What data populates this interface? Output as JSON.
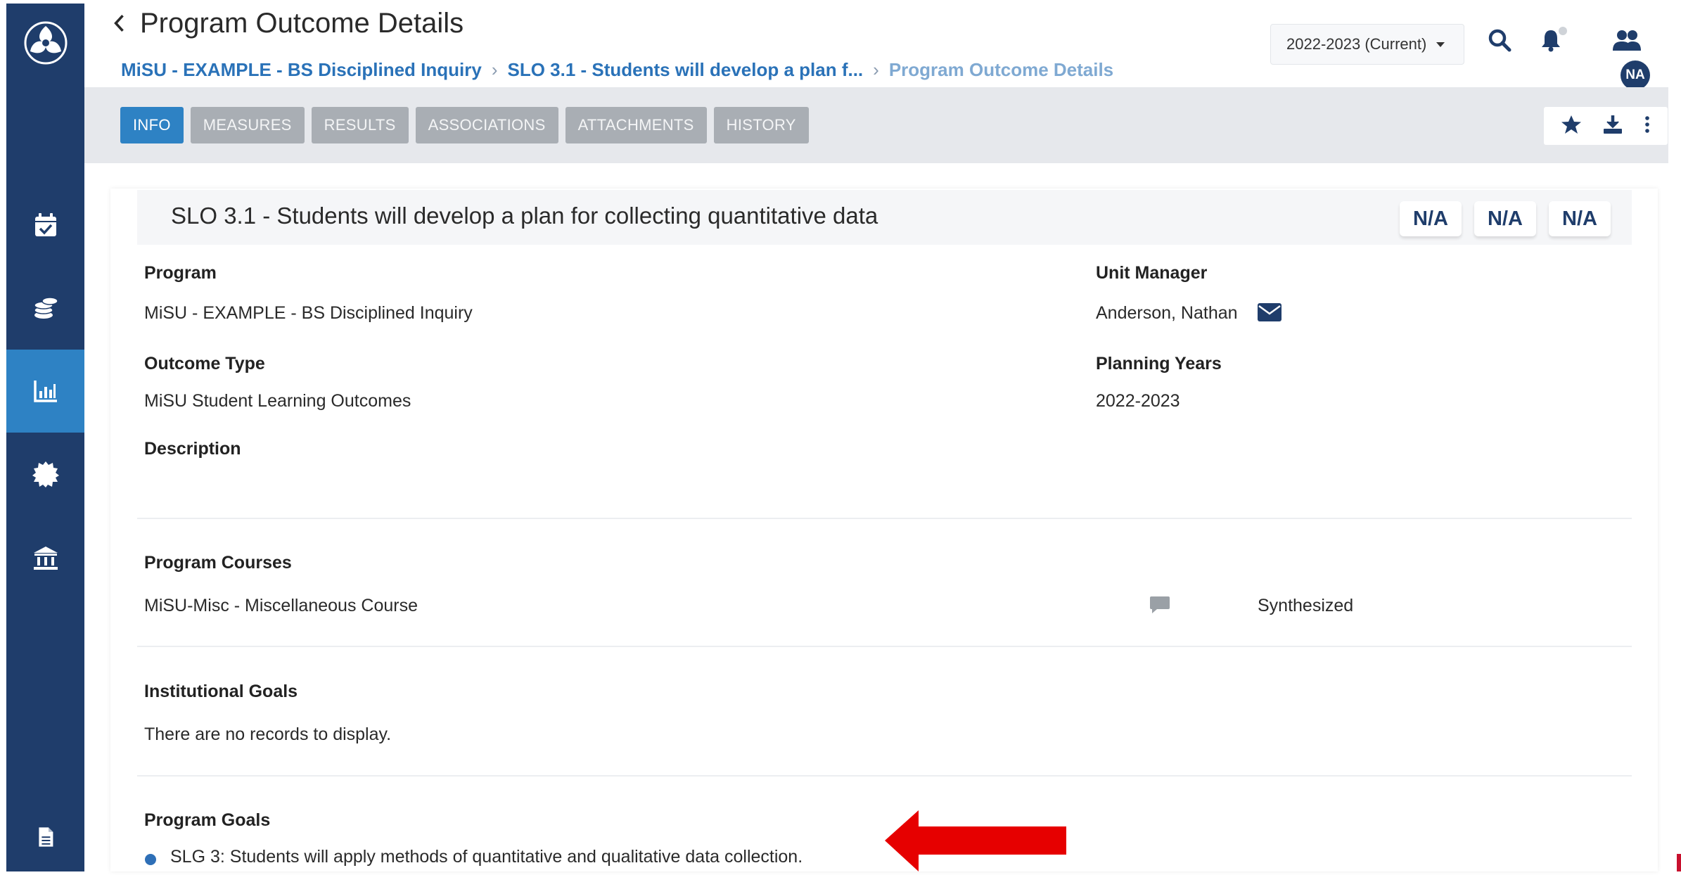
{
  "header": {
    "title": "Program Outcome Details",
    "breadcrumbs": [
      {
        "label": "MiSU - EXAMPLE - BS Disciplined Inquiry"
      },
      {
        "label": "SLO 3.1 - Students will develop a plan f..."
      },
      {
        "label": "Program Outcome Details"
      }
    ],
    "year_selector": "2022-2023 (Current)",
    "avatar_initials": "NA"
  },
  "tabs": [
    "INFO",
    "MEASURES",
    "RESULTS",
    "ASSOCIATIONS",
    "ATTACHMENTS",
    "HISTORY"
  ],
  "active_tab": "INFO",
  "outcome": {
    "title": "SLO 3.1 - Students will develop a plan for collecting quantitative data",
    "badges": [
      "N/A",
      "N/A",
      "N/A"
    ],
    "program_label": "Program",
    "program_value": "MiSU - EXAMPLE - BS Disciplined Inquiry",
    "unit_manager_label": "Unit Manager",
    "unit_manager_value": "Anderson, Nathan",
    "outcome_type_label": "Outcome Type",
    "outcome_type_value": "MiSU Student Learning Outcomes",
    "planning_years_label": "Planning Years",
    "planning_years_value": "2022-2023",
    "description_label": "Description",
    "courses_label": "Program Courses",
    "course_name": "MiSU-Misc - Miscellaneous Course",
    "course_level": "Synthesized",
    "inst_goals_label": "Institutional Goals",
    "inst_goals_empty": "There are no records to display.",
    "program_goals_label": "Program Goals",
    "program_goal_item": "SLG 3: Students will apply methods of quantitative and qualitative data collection."
  },
  "colors": {
    "sidebar": "#1f3d6b",
    "accent": "#2e82c4",
    "annotation_arrow": "#e60000"
  }
}
